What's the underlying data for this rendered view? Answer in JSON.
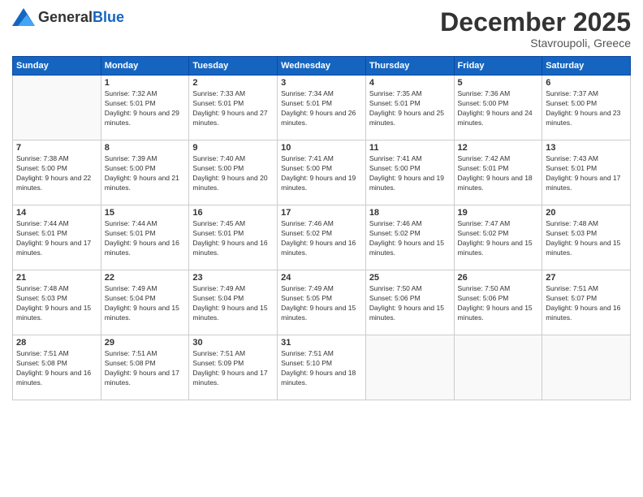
{
  "logo": {
    "general": "General",
    "blue": "Blue"
  },
  "header": {
    "month": "December 2025",
    "location": "Stavroupoli, Greece"
  },
  "weekdays": [
    "Sunday",
    "Monday",
    "Tuesday",
    "Wednesday",
    "Thursday",
    "Friday",
    "Saturday"
  ],
  "weeks": [
    [
      {
        "day": "",
        "sunrise": "",
        "sunset": "",
        "daylight": ""
      },
      {
        "day": "1",
        "sunrise": "Sunrise: 7:32 AM",
        "sunset": "Sunset: 5:01 PM",
        "daylight": "Daylight: 9 hours and 29 minutes."
      },
      {
        "day": "2",
        "sunrise": "Sunrise: 7:33 AM",
        "sunset": "Sunset: 5:01 PM",
        "daylight": "Daylight: 9 hours and 27 minutes."
      },
      {
        "day": "3",
        "sunrise": "Sunrise: 7:34 AM",
        "sunset": "Sunset: 5:01 PM",
        "daylight": "Daylight: 9 hours and 26 minutes."
      },
      {
        "day": "4",
        "sunrise": "Sunrise: 7:35 AM",
        "sunset": "Sunset: 5:01 PM",
        "daylight": "Daylight: 9 hours and 25 minutes."
      },
      {
        "day": "5",
        "sunrise": "Sunrise: 7:36 AM",
        "sunset": "Sunset: 5:00 PM",
        "daylight": "Daylight: 9 hours and 24 minutes."
      },
      {
        "day": "6",
        "sunrise": "Sunrise: 7:37 AM",
        "sunset": "Sunset: 5:00 PM",
        "daylight": "Daylight: 9 hours and 23 minutes."
      }
    ],
    [
      {
        "day": "7",
        "sunrise": "Sunrise: 7:38 AM",
        "sunset": "Sunset: 5:00 PM",
        "daylight": "Daylight: 9 hours and 22 minutes."
      },
      {
        "day": "8",
        "sunrise": "Sunrise: 7:39 AM",
        "sunset": "Sunset: 5:00 PM",
        "daylight": "Daylight: 9 hours and 21 minutes."
      },
      {
        "day": "9",
        "sunrise": "Sunrise: 7:40 AM",
        "sunset": "Sunset: 5:00 PM",
        "daylight": "Daylight: 9 hours and 20 minutes."
      },
      {
        "day": "10",
        "sunrise": "Sunrise: 7:41 AM",
        "sunset": "Sunset: 5:00 PM",
        "daylight": "Daylight: 9 hours and 19 minutes."
      },
      {
        "day": "11",
        "sunrise": "Sunrise: 7:41 AM",
        "sunset": "Sunset: 5:00 PM",
        "daylight": "Daylight: 9 hours and 19 minutes."
      },
      {
        "day": "12",
        "sunrise": "Sunrise: 7:42 AM",
        "sunset": "Sunset: 5:01 PM",
        "daylight": "Daylight: 9 hours and 18 minutes."
      },
      {
        "day": "13",
        "sunrise": "Sunrise: 7:43 AM",
        "sunset": "Sunset: 5:01 PM",
        "daylight": "Daylight: 9 hours and 17 minutes."
      }
    ],
    [
      {
        "day": "14",
        "sunrise": "Sunrise: 7:44 AM",
        "sunset": "Sunset: 5:01 PM",
        "daylight": "Daylight: 9 hours and 17 minutes."
      },
      {
        "day": "15",
        "sunrise": "Sunrise: 7:44 AM",
        "sunset": "Sunset: 5:01 PM",
        "daylight": "Daylight: 9 hours and 16 minutes."
      },
      {
        "day": "16",
        "sunrise": "Sunrise: 7:45 AM",
        "sunset": "Sunset: 5:01 PM",
        "daylight": "Daylight: 9 hours and 16 minutes."
      },
      {
        "day": "17",
        "sunrise": "Sunrise: 7:46 AM",
        "sunset": "Sunset: 5:02 PM",
        "daylight": "Daylight: 9 hours and 16 minutes."
      },
      {
        "day": "18",
        "sunrise": "Sunrise: 7:46 AM",
        "sunset": "Sunset: 5:02 PM",
        "daylight": "Daylight: 9 hours and 15 minutes."
      },
      {
        "day": "19",
        "sunrise": "Sunrise: 7:47 AM",
        "sunset": "Sunset: 5:02 PM",
        "daylight": "Daylight: 9 hours and 15 minutes."
      },
      {
        "day": "20",
        "sunrise": "Sunrise: 7:48 AM",
        "sunset": "Sunset: 5:03 PM",
        "daylight": "Daylight: 9 hours and 15 minutes."
      }
    ],
    [
      {
        "day": "21",
        "sunrise": "Sunrise: 7:48 AM",
        "sunset": "Sunset: 5:03 PM",
        "daylight": "Daylight: 9 hours and 15 minutes."
      },
      {
        "day": "22",
        "sunrise": "Sunrise: 7:49 AM",
        "sunset": "Sunset: 5:04 PM",
        "daylight": "Daylight: 9 hours and 15 minutes."
      },
      {
        "day": "23",
        "sunrise": "Sunrise: 7:49 AM",
        "sunset": "Sunset: 5:04 PM",
        "daylight": "Daylight: 9 hours and 15 minutes."
      },
      {
        "day": "24",
        "sunrise": "Sunrise: 7:49 AM",
        "sunset": "Sunset: 5:05 PM",
        "daylight": "Daylight: 9 hours and 15 minutes."
      },
      {
        "day": "25",
        "sunrise": "Sunrise: 7:50 AM",
        "sunset": "Sunset: 5:06 PM",
        "daylight": "Daylight: 9 hours and 15 minutes."
      },
      {
        "day": "26",
        "sunrise": "Sunrise: 7:50 AM",
        "sunset": "Sunset: 5:06 PM",
        "daylight": "Daylight: 9 hours and 15 minutes."
      },
      {
        "day": "27",
        "sunrise": "Sunrise: 7:51 AM",
        "sunset": "Sunset: 5:07 PM",
        "daylight": "Daylight: 9 hours and 16 minutes."
      }
    ],
    [
      {
        "day": "28",
        "sunrise": "Sunrise: 7:51 AM",
        "sunset": "Sunset: 5:08 PM",
        "daylight": "Daylight: 9 hours and 16 minutes."
      },
      {
        "day": "29",
        "sunrise": "Sunrise: 7:51 AM",
        "sunset": "Sunset: 5:08 PM",
        "daylight": "Daylight: 9 hours and 17 minutes."
      },
      {
        "day": "30",
        "sunrise": "Sunrise: 7:51 AM",
        "sunset": "Sunset: 5:09 PM",
        "daylight": "Daylight: 9 hours and 17 minutes."
      },
      {
        "day": "31",
        "sunrise": "Sunrise: 7:51 AM",
        "sunset": "Sunset: 5:10 PM",
        "daylight": "Daylight: 9 hours and 18 minutes."
      },
      {
        "day": "",
        "sunrise": "",
        "sunset": "",
        "daylight": ""
      },
      {
        "day": "",
        "sunrise": "",
        "sunset": "",
        "daylight": ""
      },
      {
        "day": "",
        "sunrise": "",
        "sunset": "",
        "daylight": ""
      }
    ]
  ]
}
